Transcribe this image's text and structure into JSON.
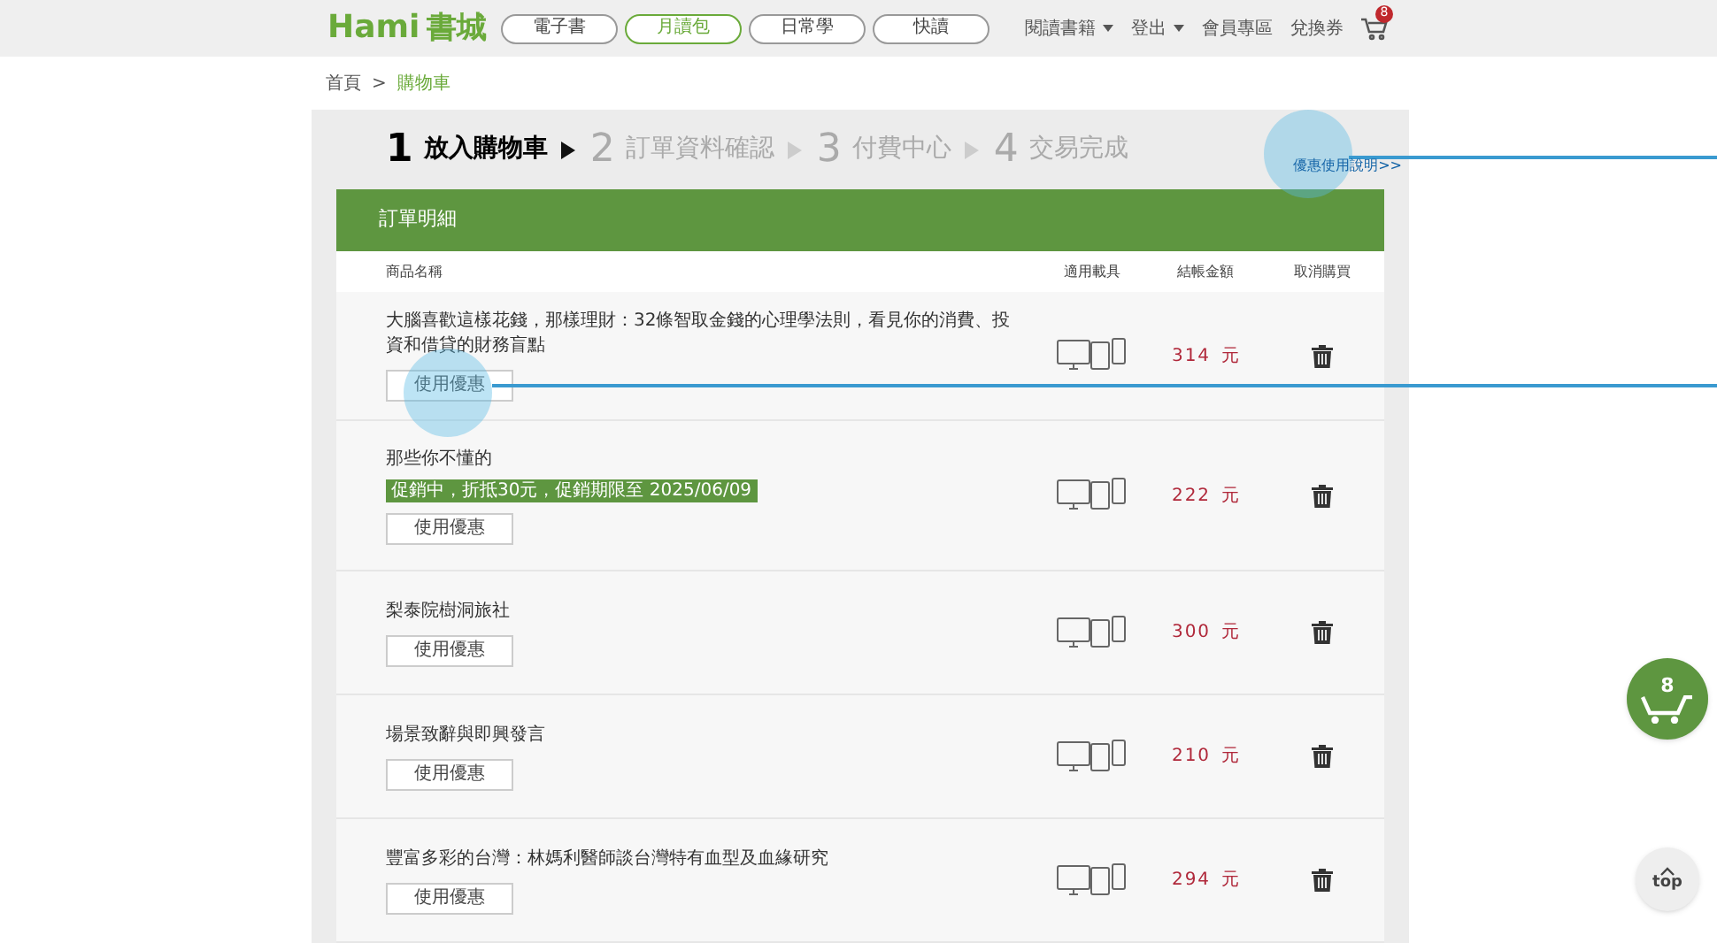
{
  "header": {
    "logo": "Hami",
    "logo_sub": "書城",
    "nav": [
      {
        "label": "電子書",
        "selected": false
      },
      {
        "label": "月讀包",
        "selected": true
      },
      {
        "label": "日常學",
        "selected": false
      },
      {
        "label": "快讀",
        "selected": false
      }
    ],
    "menu": [
      {
        "label": "閱讀書籍",
        "dropdown": true
      },
      {
        "label": "登出",
        "dropdown": true
      },
      {
        "label": "會員專區",
        "dropdown": false
      },
      {
        "label": "兌換券",
        "dropdown": false
      }
    ],
    "cart_count": "8"
  },
  "breadcrumb": [
    "首頁",
    ">",
    "購物車"
  ],
  "steps": [
    {
      "number": "1",
      "label": "放入購物車",
      "selected": true
    },
    {
      "number": "2",
      "label": "訂單資料確認",
      "selected": false
    },
    {
      "number": "3",
      "label": "付費中心",
      "selected": false
    },
    {
      "number": "4",
      "label": "交易完成",
      "selected": false
    }
  ],
  "coupon_help_link": "優惠使用說明>>",
  "order": {
    "title": "訂單明細",
    "columns": [
      "商品名稱",
      "適用載具",
      "結帳金額",
      "取消購買"
    ],
    "rows": [
      {
        "name": "大腦喜歡這樣花錢，那樣理財：32條智取金錢的心理學法則，看見你的消費、投資和借貸的財務盲點",
        "coupon": "使用優惠",
        "price": "314",
        "unit": "元"
      },
      {
        "name": "那些你不懂的",
        "promo": "促銷中，折抵30元，促銷期限至 2025/06/09",
        "coupon": "使用優惠",
        "price": "222",
        "unit": "元"
      },
      {
        "name": "梨泰院樹洞旅社",
        "coupon": "使用優惠",
        "price": "300",
        "unit": "元"
      },
      {
        "name": "場景致辭與即興發言",
        "coupon": "使用優惠",
        "price": "210",
        "unit": "元"
      },
      {
        "name": "豐富多彩的台灣：林媽利醫師談台灣特有血型及血緣研究",
        "coupon": "使用優惠",
        "price": "294",
        "unit": "元"
      }
    ]
  },
  "floating_cart": {
    "count": "8"
  },
  "top_button": {
    "label": "top"
  }
}
